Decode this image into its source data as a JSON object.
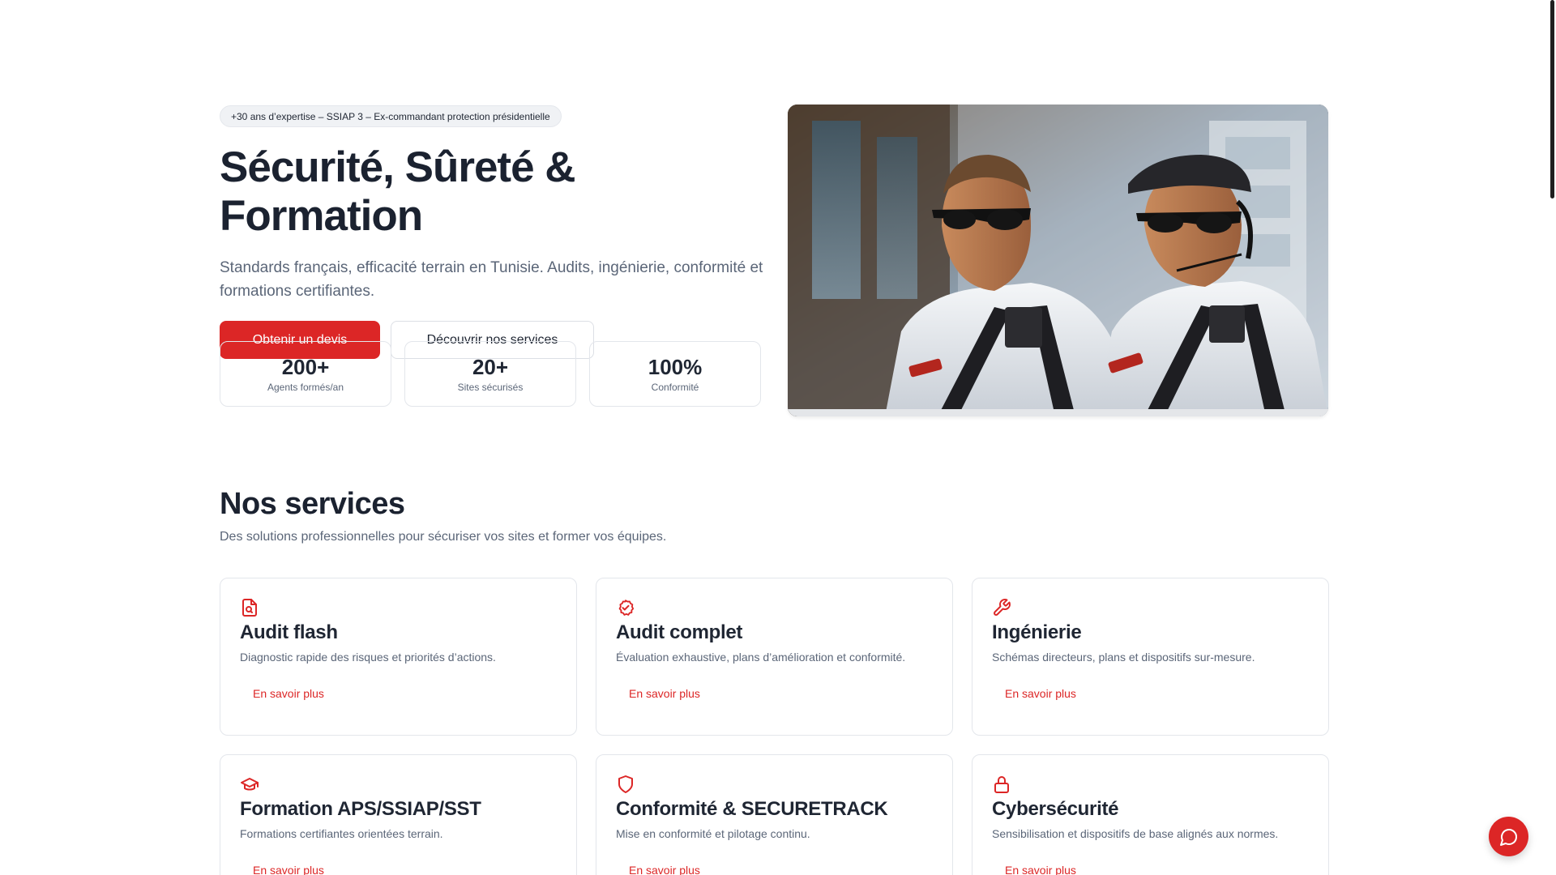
{
  "hero": {
    "badge": "+30 ans d’expertise – SSIAP 3 – Ex-commandant protection présidentielle",
    "title": "Sécurité, Sûreté & Formation",
    "subtitle": "Standards français, efficacité terrain en Tunisie. Audits, ingénierie, conformité et formations certifiantes.",
    "primary_cta": "Obtenir un devis",
    "secondary_cta": "Découvrir nos services",
    "photo_alt": "Two security agents wearing sunglasses and headsets in front of a building",
    "stats": [
      {
        "value": "200+",
        "label": "Agents formés/an"
      },
      {
        "value": "20+",
        "label": "Sites sécurisés"
      },
      {
        "value": "100%",
        "label": "Conformité"
      }
    ]
  },
  "services": {
    "title": "Nos services",
    "subtitle": "Des solutions professionnelles pour sécuriser vos sites et former vos équipes.",
    "cards": [
      {
        "icon": "document-search-icon",
        "title": "Audit flash",
        "description": "Diagnostic rapide des risques et priorités d’actions.",
        "link": "En savoir plus"
      },
      {
        "icon": "check-badge-icon",
        "title": "Audit complet",
        "description": "Évaluation exhaustive, plans d’amélioration et conformité.",
        "link": "En savoir plus"
      },
      {
        "icon": "wrench-icon",
        "title": "Ingénierie",
        "description": "Schémas directeurs, plans et dispositifs sur-mesure.",
        "link": "En savoir plus"
      },
      {
        "icon": "graduation-cap-icon",
        "title": "Formation APS/SSIAP/SST",
        "description": "Formations certifiantes orientées terrain.",
        "link": "En savoir plus"
      },
      {
        "icon": "shield-icon",
        "title": "Conformité & SECURETRACK",
        "description": "Mise en conformité et pilotage continu.",
        "link": "En savoir plus"
      },
      {
        "icon": "lock-icon",
        "title": "Cybersécurité",
        "description": "Sensibilisation et dispositifs de base alignés aux normes.",
        "link": "En savoir plus"
      }
    ]
  },
  "chat": {
    "icon": "chat-bubble-icon"
  },
  "colors": {
    "accent": "#dc2626",
    "heading": "#1b2230",
    "muted": "#5b6678",
    "border": "#e3e6eb"
  }
}
